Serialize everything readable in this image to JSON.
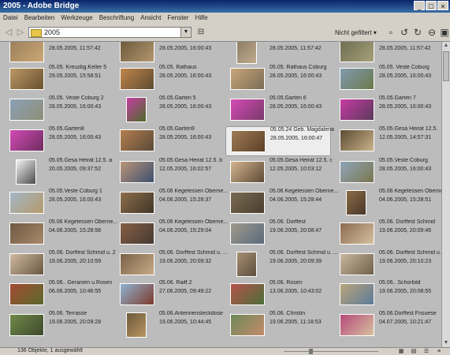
{
  "window": {
    "title": "2005 - Adobe Bridge",
    "controls": [
      "_",
      "□",
      "×"
    ]
  },
  "menu": [
    "Datei",
    "Bearbeiten",
    "Werkzeuge",
    "Beschriftung",
    "Ansicht",
    "Fenster",
    "Hilfe"
  ],
  "toolbar": {
    "back": "◁",
    "forward": "▷",
    "path": "2005",
    "filter": "Nicht gefiltert ▾",
    "icons": [
      "camera-icon",
      "rotate-left-icon",
      "rotate-right-icon",
      "trash-icon",
      "window-icon"
    ]
  },
  "thumbnails": [
    {
      "name": "",
      "date": "28.05.2005, 11:57:42",
      "colors": [
        "#9b7f5b",
        "#caa775"
      ]
    },
    {
      "name": "",
      "date": "28.05.2005, 16:00:43",
      "colors": [
        "#6c5a3a",
        "#b39670"
      ]
    },
    {
      "name": "",
      "date": "28.05.2005, 11:57:42",
      "colors": [
        "#8a7a65",
        "#c1ad8d"
      ]
    },
    {
      "name": "",
      "date": "28.05.2005, 11:57:42",
      "colors": [
        "#6d6d4f",
        "#a7a07a"
      ]
    },
    {
      "name": "05.05. Kreuzbg.Keller 5",
      "date": "29.05.2005, 15:58:51",
      "colors": [
        "#b99863",
        "#6b5131"
      ]
    },
    {
      "name": "05.05. Rathaus",
      "date": "28.05.2005, 16:00:43",
      "colors": [
        "#c0864c",
        "#5e4a30"
      ]
    },
    {
      "name": "05.05. Rathaus Coburg",
      "date": "28.05.2005, 16:00:43",
      "colors": [
        "#c9a77a",
        "#7b6a55"
      ]
    },
    {
      "name": "05.05. Veste Coburg",
      "date": "28.05.2005, 16:00:43",
      "colors": [
        "#7f9ab0",
        "#6a7a4a"
      ]
    },
    {
      "name": "05.05. Veste Coburg 2",
      "date": "28.05.2005, 16:00:43",
      "colors": [
        "#8aa0b6",
        "#8f8f76"
      ]
    },
    {
      "name": "05.05.Garten 5",
      "date": "28.05.2005, 16:00:43",
      "colors": [
        "#c53da1",
        "#4d6a2a"
      ]
    },
    {
      "name": "05.05.Garten 6",
      "date": "28.05.2005, 16:00:43",
      "colors": [
        "#d44ab6",
        "#7a3a6a"
      ]
    },
    {
      "name": "05.05.Garten 7",
      "date": "28.05.2005, 16:00:43",
      "colors": [
        "#c83aa4",
        "#5a3a5a"
      ]
    },
    {
      "name": "05.05.Garten8",
      "date": "28.05.2005, 16:00:43",
      "colors": [
        "#d24bb5",
        "#6e2d5f"
      ]
    },
    {
      "name": "05.05.Garten9",
      "date": "28.05.2005, 16:00:43",
      "colors": [
        "#b37e4f",
        "#5a4a38"
      ]
    },
    {
      "name": "05.05.24 Geb. Magdalena",
      "date": "28.05.2005, 16:00:47",
      "colors": [
        "#9f7b55",
        "#5b4027"
      ]
    },
    {
      "name": "05.05.Gesa Heirat 12.5.",
      "date": "12.05.2005, 14:57:31",
      "colors": [
        "#5e4a33",
        "#c8b48a"
      ]
    },
    {
      "name": "05.05.Gesa Heirat 12.5. a",
      "date": "20.05.2005, 09:37:52",
      "colors": [
        "#f2f2f2",
        "#4c4c4c"
      ]
    },
    {
      "name": "05.05.Gesa Heirat 12.5. b",
      "date": "12.05.2005, 16:02:57",
      "colors": [
        "#b89578",
        "#3f4f6e"
      ]
    },
    {
      "name": "05.05.Gesa Heirat 12.5. c",
      "date": "12.05.2005, 10:03:12",
      "colors": [
        "#d4b48f",
        "#5d4a36"
      ]
    },
    {
      "name": "05.05.Veste Coburg",
      "date": "28.05.2005, 16:00:43",
      "colors": [
        "#8ea5b8",
        "#7b7650"
      ]
    },
    {
      "name": "05.05.Veste Coburg 1",
      "date": "28.05.2005, 16:00:43",
      "colors": [
        "#a3b6c5",
        "#b59a6b"
      ]
    },
    {
      "name": "05.06 Kegelessen Oberne...",
      "date": "04.06.2005, 15:28:37",
      "colors": [
        "#8e6f4c",
        "#3f3427"
      ]
    },
    {
      "name": "05.06 Kegelessen Oberne...",
      "date": "04.06.2005, 15:28:44",
      "colors": [
        "#7a6b52",
        "#4a3d2e"
      ]
    },
    {
      "name": "05.06 Kegelessen Oberne...",
      "date": "04.06.2005, 15:28:51",
      "colors": [
        "#8b6b45",
        "#49382a"
      ]
    },
    {
      "name": "05.06 Kegelessen Oberne...",
      "date": "04.06.2005, 15:28:58",
      "colors": [
        "#6e5842",
        "#a9896a"
      ]
    },
    {
      "name": "05.06 Kegelessen Oberne...",
      "date": "04.06.2005, 15:29:04",
      "colors": [
        "#865f45",
        "#463a31"
      ]
    },
    {
      "name": "05.06. Dorffest",
      "date": "19.06.2005, 20:08:47",
      "colors": [
        "#a19a8d",
        "#596a7a"
      ]
    },
    {
      "name": "05.06. Dorffest Schmid",
      "date": "19.06.2005, 20:09:46",
      "colors": [
        "#8d6a4e",
        "#d4c0a0"
      ]
    },
    {
      "name": "05.06. Dorffest Schmid u. 2",
      "date": "19.06.2005, 20:10:59",
      "colors": [
        "#cfb9a0",
        "#6a5740"
      ]
    },
    {
      "name": "05.06. Dorffest Schmid u. ...",
      "date": "19.06.2005, 20:09:32",
      "colors": [
        "#7a6248",
        "#c7a985"
      ]
    },
    {
      "name": "05.06. Dorffest Schmid u. ...",
      "date": "19.06.2005, 20:09:39",
      "colors": [
        "#a68e73",
        "#5e4f3e"
      ]
    },
    {
      "name": "05.06. Dorffest Schmid u. ...",
      "date": "19.06.2005, 20:10:23",
      "colors": [
        "#c9b79f",
        "#70604a"
      ]
    },
    {
      "name": "05.06.. Geranien u.Rosen",
      "date": "06.06.2005, 10:46:55",
      "colors": [
        "#a34b32",
        "#5a6a2e"
      ]
    },
    {
      "name": "05.06. Raiff.2",
      "date": "27.06.2005, 09:49:22",
      "colors": [
        "#8fb2d2",
        "#7d3b2a"
      ]
    },
    {
      "name": "05.06. Rosen",
      "date": "13.06.2005, 10:43:02",
      "colors": [
        "#b4534a",
        "#4d6e3a"
      ]
    },
    {
      "name": "05.06.. Schorbild",
      "date": "19.06.2005, 20:08:55",
      "colors": [
        "#b9a57a",
        "#5d7a9a"
      ]
    },
    {
      "name": "05.06. Terrasse",
      "date": "19.06.2005, 20:09:28",
      "colors": [
        "#70894a",
        "#3e4a2d"
      ]
    },
    {
      "name": "05.06.Antennensteckdose",
      "date": "19.06.2005, 10:44:45",
      "colors": [
        "#6d5a3e",
        "#b8955f"
      ]
    },
    {
      "name": "05.06. Christin",
      "date": "19.06.2005, 11:18:53",
      "colors": [
        "#6e8a5a",
        "#c38a6a"
      ]
    },
    {
      "name": "05.06.Dorffest Frisuese",
      "date": "04.07.2005, 10:21:47",
      "colors": [
        "#b54a7a",
        "#d8c0a0"
      ]
    }
  ],
  "selected_index": 14,
  "status": {
    "text": "136 Objekte, 1 ausgewählt"
  }
}
